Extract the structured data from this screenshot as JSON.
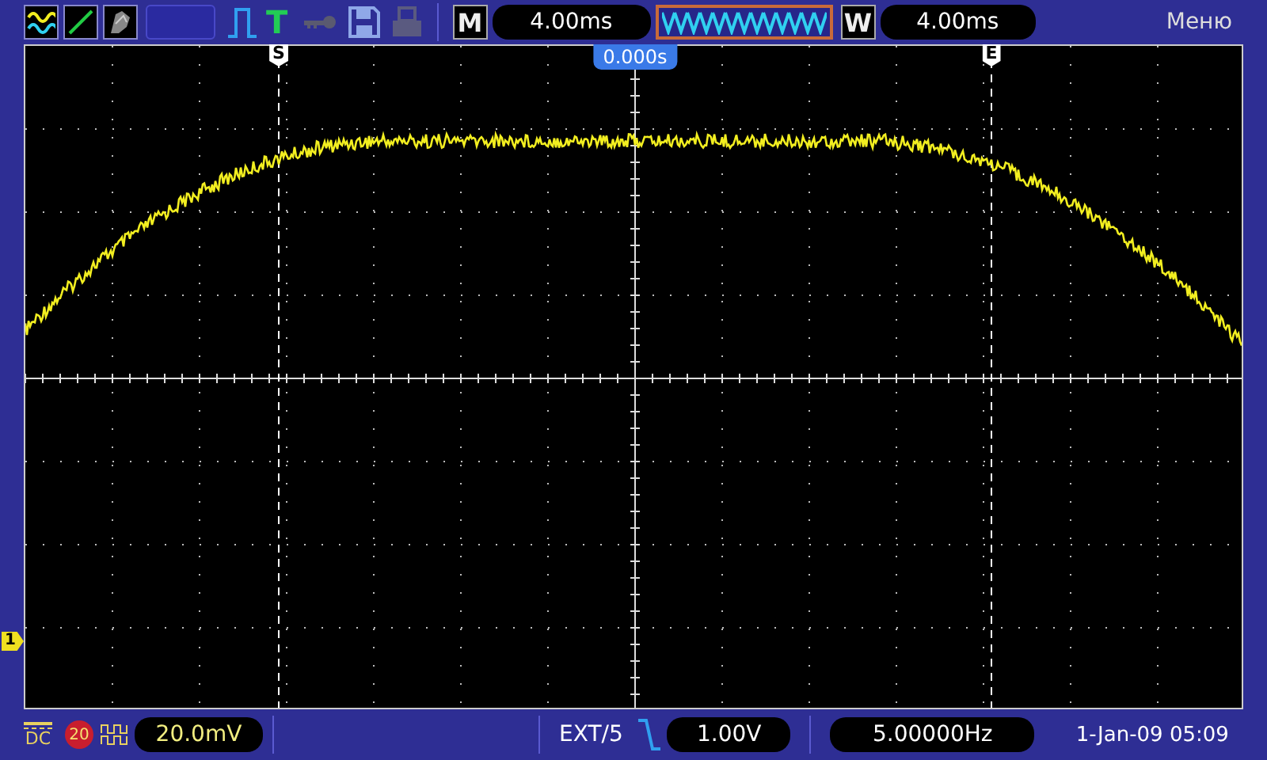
{
  "top_bar": {
    "trigger_type_label": "T",
    "timebase_label": "M",
    "timebase": "4.00ms",
    "window_label": "W",
    "window": "4.00ms",
    "menu": "Меню"
  },
  "screen": {
    "start_marker": "S",
    "end_marker": "E",
    "trigger_position": "0.000s",
    "channel_marker": "1"
  },
  "bottom_bar": {
    "coupling": "DC",
    "bandwidth_limit": "20",
    "volts_div": "20.0mV",
    "trigger_source": "EXT/5",
    "trigger_level": "1.00V",
    "frequency": "5.00000Hz",
    "datetime": "1-Jan-09 05:09"
  }
}
